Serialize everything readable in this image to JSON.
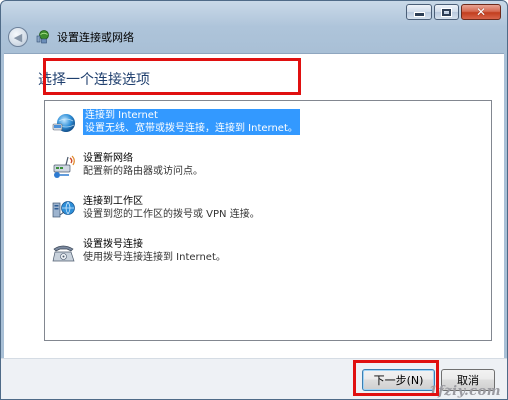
{
  "window": {
    "title": "设置连接或网络",
    "back_glyph": "◀",
    "close_glyph": "✕"
  },
  "content": {
    "heading": "选择一个连接选项",
    "options": [
      {
        "title": "连接到 Internet",
        "description": "设置无线、宽带或拨号连接，连接到 Internet。",
        "icon": "globe-network-icon",
        "selected": true
      },
      {
        "title": "设置新网络",
        "description": "配置新的路由器或访问点。",
        "icon": "router-setup-icon",
        "selected": false
      },
      {
        "title": "连接到工作区",
        "description": "设置到您的工作区的拨号或 VPN 连接。",
        "icon": "workplace-network-icon",
        "selected": false
      },
      {
        "title": "设置拨号连接",
        "description": "使用拨号连接连接到 Internet。",
        "icon": "dialup-phone-icon",
        "selected": false
      }
    ]
  },
  "footer": {
    "next_label": "下一步(N)",
    "cancel_label": "取消"
  },
  "watermark": "1fziy.com",
  "colors": {
    "selection": "#3399ff",
    "highlight_box": "#e01010",
    "heading": "#1f3f6e"
  }
}
